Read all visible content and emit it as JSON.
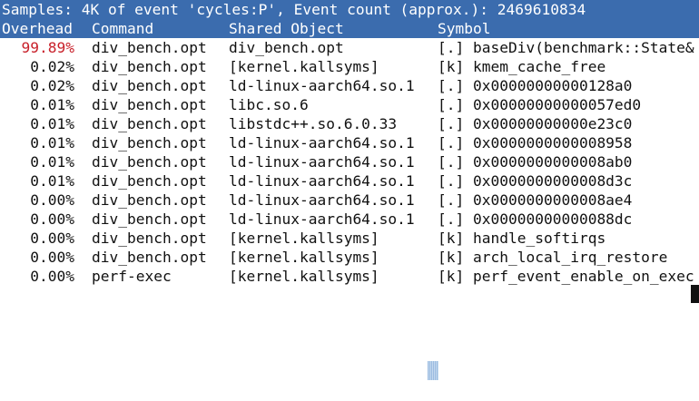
{
  "title_bar": {
    "text": "Samples: 4K of event 'cycles:P', Event count (approx.): 2469610834"
  },
  "columns": {
    "overhead": "Overhead",
    "command": "Command",
    "shared_object": "Shared Object",
    "symbol": "Symbol"
  },
  "rows": [
    {
      "overhead": "99.89%",
      "command": "div_bench.opt",
      "shared_object": "div_bench.opt",
      "level": "[.]",
      "symbol": "baseDiv(benchmark::State&"
    },
    {
      "overhead": "0.02%",
      "command": "div_bench.opt",
      "shared_object": "[kernel.kallsyms]",
      "level": "[k]",
      "symbol": "kmem_cache_free"
    },
    {
      "overhead": "0.02%",
      "command": "div_bench.opt",
      "shared_object": "ld-linux-aarch64.so.1",
      "level": "[.]",
      "symbol": "0x00000000000128a0"
    },
    {
      "overhead": "0.01%",
      "command": "div_bench.opt",
      "shared_object": "libc.so.6",
      "level": "[.]",
      "symbol": "0x00000000000057ed0"
    },
    {
      "overhead": "0.01%",
      "command": "div_bench.opt",
      "shared_object": "libstdc++.so.6.0.33",
      "level": "[.]",
      "symbol": "0x00000000000e23c0"
    },
    {
      "overhead": "0.01%",
      "command": "div_bench.opt",
      "shared_object": "ld-linux-aarch64.so.1",
      "level": "[.]",
      "symbol": "0x0000000000008958"
    },
    {
      "overhead": "0.01%",
      "command": "div_bench.opt",
      "shared_object": "ld-linux-aarch64.so.1",
      "level": "[.]",
      "symbol": "0x0000000000008ab0"
    },
    {
      "overhead": "0.01%",
      "command": "div_bench.opt",
      "shared_object": "ld-linux-aarch64.so.1",
      "level": "[.]",
      "symbol": "0x0000000000008d3c"
    },
    {
      "overhead": "0.00%",
      "command": "div_bench.opt",
      "shared_object": "ld-linux-aarch64.so.1",
      "level": "[.]",
      "symbol": "0x0000000000008ae4"
    },
    {
      "overhead": "0.00%",
      "command": "div_bench.opt",
      "shared_object": "ld-linux-aarch64.so.1",
      "level": "[.]",
      "symbol": "0x00000000000088dc"
    },
    {
      "overhead": "0.00%",
      "command": "div_bench.opt",
      "shared_object": "[kernel.kallsyms]",
      "level": "[k]",
      "symbol": "handle_softirqs"
    },
    {
      "overhead": "0.00%",
      "command": "div_bench.opt",
      "shared_object": "[kernel.kallsyms]",
      "level": "[k]",
      "symbol": "arch_local_irq_restore"
    },
    {
      "overhead": "0.00%",
      "command": "perf-exec",
      "shared_object": "[kernel.kallsyms]",
      "level": "[k]",
      "symbol": "perf_event_enable_on_exec"
    }
  ],
  "colors": {
    "header_background": "#3b6cae",
    "header_text": "#ffffff",
    "hot_overhead": "#c8202a",
    "text": "#111111",
    "background": "#ffffff"
  }
}
